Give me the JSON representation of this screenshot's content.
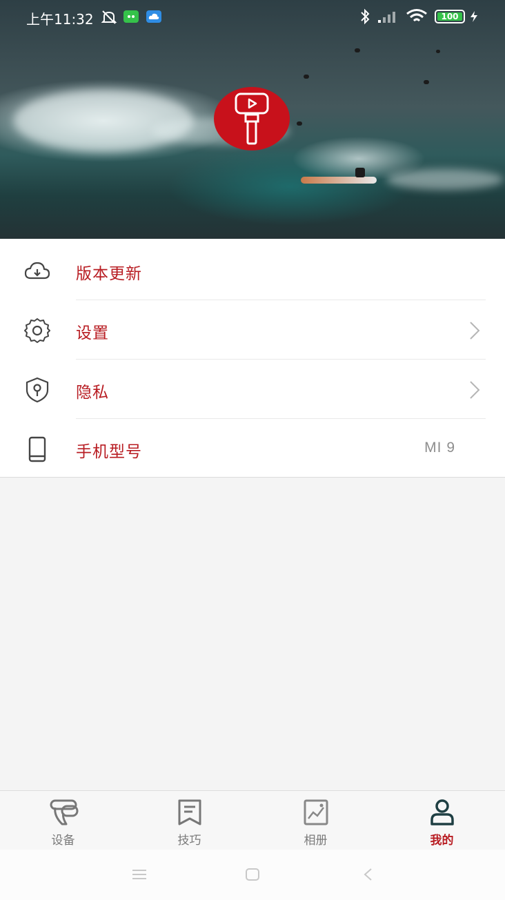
{
  "status_bar": {
    "time": "上午11:32",
    "battery": "100"
  },
  "menu": {
    "items": [
      {
        "label": "版本更新",
        "icon": "cloud-download-icon"
      },
      {
        "label": "设置",
        "icon": "gear-icon"
      },
      {
        "label": "隐私",
        "icon": "shield-lock-icon"
      },
      {
        "label": "手机型号",
        "icon": "phone-icon",
        "value": "MI 9"
      }
    ]
  },
  "tabbar": {
    "tabs": [
      {
        "label": "设备",
        "icon": "gimbal-icon"
      },
      {
        "label": "技巧",
        "icon": "bookmark-icon"
      },
      {
        "label": "相册",
        "icon": "gallery-icon"
      },
      {
        "label": "我的",
        "icon": "person-icon",
        "active": true
      }
    ]
  },
  "colors": {
    "accent": "#b81c22",
    "logo_red": "#c8111b",
    "background": "#f4f4f4"
  }
}
